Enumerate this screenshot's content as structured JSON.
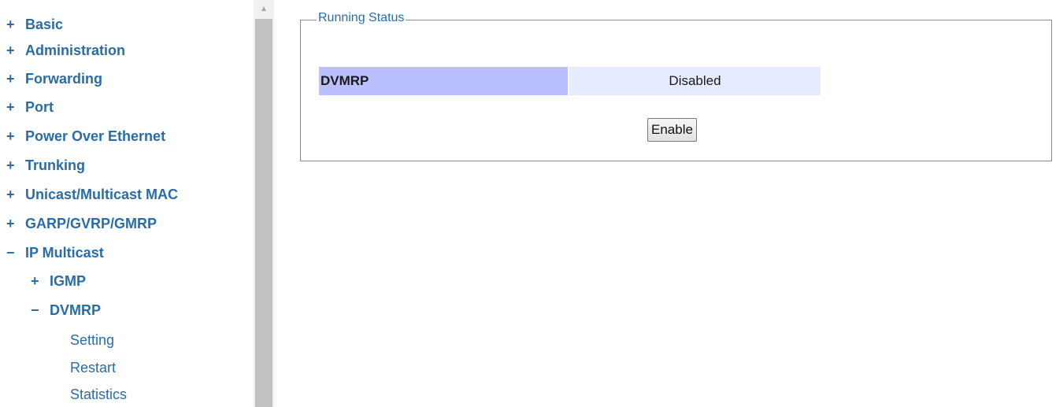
{
  "sidebar": {
    "items": [
      {
        "sign": "+",
        "label": "Basic"
      },
      {
        "sign": "+",
        "label": "Administration"
      },
      {
        "sign": "+",
        "label": "Forwarding"
      },
      {
        "sign": "+",
        "label": "Port"
      },
      {
        "sign": "+",
        "label": "Power Over Ethernet"
      },
      {
        "sign": "+",
        "label": "Trunking"
      },
      {
        "sign": "+",
        "label": "Unicast/Multicast MAC"
      },
      {
        "sign": "+",
        "label": "GARP/GVRP/GMRP"
      },
      {
        "sign": "−",
        "label": "IP Multicast"
      }
    ],
    "sub_items": [
      {
        "sign": "+",
        "label": "IGMP"
      },
      {
        "sign": "−",
        "label": "DVMRP"
      }
    ],
    "leaf_items": [
      {
        "label": "Setting"
      },
      {
        "label": "Restart"
      },
      {
        "label": "Statistics"
      }
    ]
  },
  "main": {
    "legend": "Running Status",
    "status": {
      "label": "DVMRP",
      "value": "Disabled"
    },
    "enable_button": "Enable"
  },
  "colors": {
    "link": "#2a6ca6",
    "status_label_bg": "#b9bfff",
    "status_value_bg": "#e6ebff"
  }
}
